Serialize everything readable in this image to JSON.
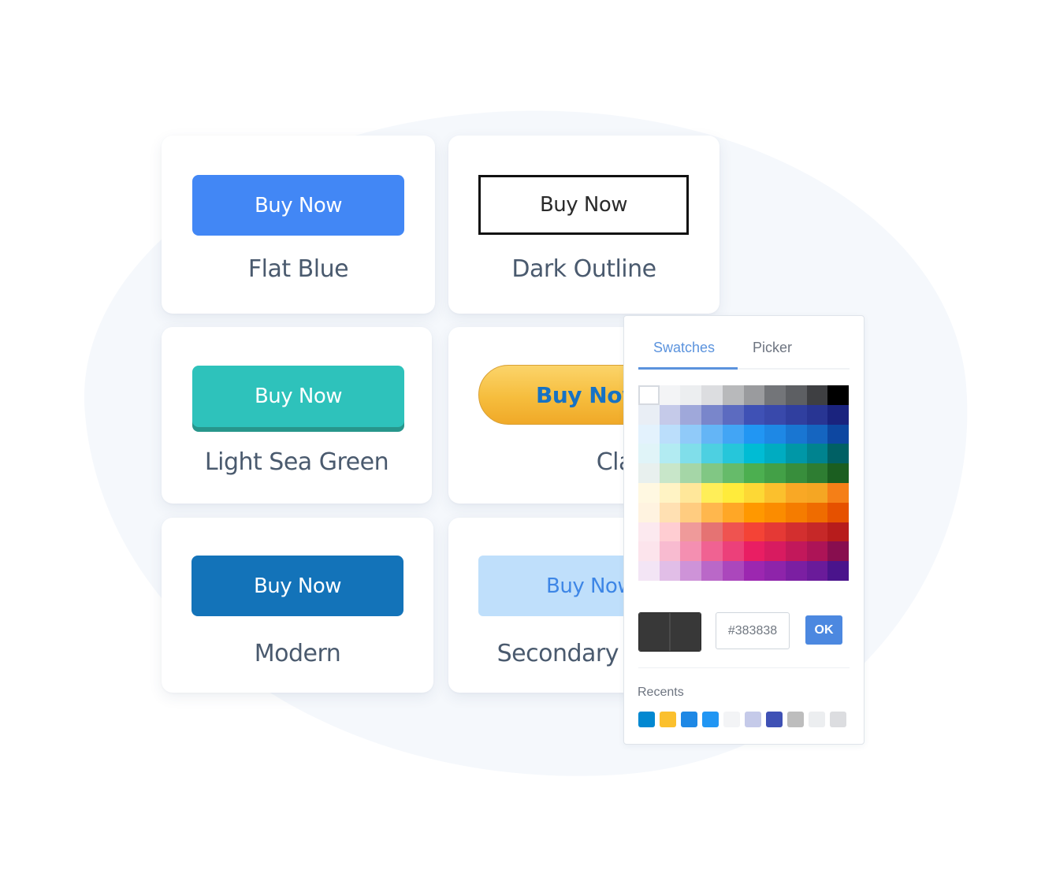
{
  "cards": [
    {
      "id": "flat-blue",
      "button_label": "Buy Now",
      "style_name": "Flat Blue",
      "button_color": "#4287f5"
    },
    {
      "id": "dark-outline",
      "button_label": "Buy Now",
      "style_name": "Dark Outline",
      "button_color": "#111111"
    },
    {
      "id": "light-sea-green",
      "button_label": "Buy Now",
      "style_name": "Light Sea Green",
      "button_color": "#2ec2bb"
    },
    {
      "id": "classic",
      "button_label": "Buy Now",
      "style_name": "Classic",
      "button_color": "#f6bd3d"
    },
    {
      "id": "modern",
      "button_label": "Buy Now",
      "style_name": "Modern",
      "button_color": "#1373b9"
    },
    {
      "id": "secondary",
      "button_label": "Buy Now",
      "style_name": "Secondary",
      "button_color": "#bfdffb"
    }
  ],
  "color_picker": {
    "tabs": [
      {
        "label": "Swatches",
        "active": true
      },
      {
        "label": "Picker",
        "active": false
      }
    ],
    "swatch_grid": [
      [
        "#ffffff",
        "#f3f4f6",
        "#eceef0",
        "#dcdde0",
        "#b8b9bb",
        "#9a9b9e",
        "#737579",
        "#5d5f63",
        "#3e3f42",
        "#000000"
      ],
      [
        "#e9eef5",
        "#c5cae9",
        "#9fa8da",
        "#7986cb",
        "#5c6bc0",
        "#3f51b5",
        "#3949ab",
        "#303f9f",
        "#283593",
        "#1a237e"
      ],
      [
        "#e3f2fd",
        "#bbdefb",
        "#90caf9",
        "#64b5f6",
        "#42a5f5",
        "#2196f3",
        "#1e88e5",
        "#1976d2",
        "#1565c0",
        "#0d47a1"
      ],
      [
        "#e0f4f8",
        "#b2ebf2",
        "#80deea",
        "#4dd0e1",
        "#26c6da",
        "#00bcd4",
        "#00acc1",
        "#0097a7",
        "#00838f",
        "#006064"
      ],
      [
        "#e8f0ee",
        "#c8e6c9",
        "#a5d6a7",
        "#81c784",
        "#66bb6a",
        "#4caf50",
        "#43a047",
        "#388e3c",
        "#2e7d32",
        "#1b5e20"
      ],
      [
        "#fff8e1",
        "#fff3c4",
        "#ffe79a",
        "#ffee58",
        "#ffeb3b",
        "#fdd835",
        "#fbc02d",
        "#f9a825",
        "#f5a623",
        "#f57f17"
      ],
      [
        "#fff3e0",
        "#ffe0b2",
        "#ffcc80",
        "#ffb74d",
        "#ffa726",
        "#ff9800",
        "#fb8c00",
        "#f57c00",
        "#ef6c00",
        "#e65100"
      ],
      [
        "#fce9ef",
        "#ffcdd2",
        "#ef9a9a",
        "#e57373",
        "#ef5350",
        "#f44336",
        "#e53935",
        "#d32f2f",
        "#c62828",
        "#b71c1c"
      ],
      [
        "#fce4ec",
        "#f8bbd0",
        "#f48fb1",
        "#f06292",
        "#ec407a",
        "#e91e63",
        "#d81b60",
        "#c2185b",
        "#ad1457",
        "#880e4f"
      ],
      [
        "#f3e5f5",
        "#e1bee7",
        "#ce93d8",
        "#ba68c8",
        "#ab47bc",
        "#9c27b0",
        "#8e24aa",
        "#7b1fa2",
        "#6a1b9a",
        "#4a148c"
      ]
    ],
    "selected_swatch": "#ffffff",
    "current_color": "#383838",
    "hex_value": "#383838",
    "ok_label": "OK",
    "recents_label": "Recents",
    "recents": [
      "#0288d1",
      "#fbc02d",
      "#1e88e5",
      "#2196f3",
      "#f3f4f6",
      "#c5cae9",
      "#3f51b5",
      "#bdbdbd",
      "#eceef0",
      "#dcdde0"
    ]
  }
}
